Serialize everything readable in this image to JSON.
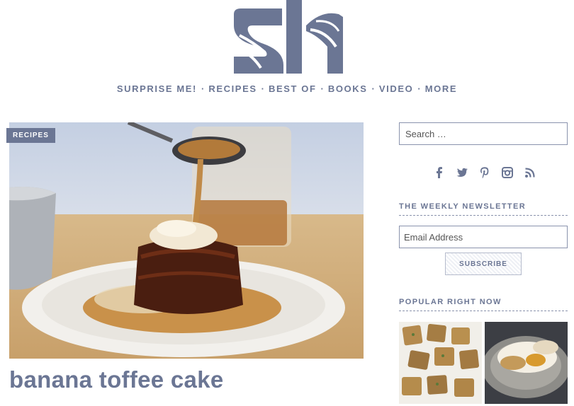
{
  "site": {
    "logo_text": "SK"
  },
  "nav": {
    "items": [
      "SURPRISE ME!",
      "RECIPES",
      "BEST OF",
      "BOOKS",
      "VIDEO",
      "MORE"
    ],
    "separator": "·"
  },
  "post": {
    "category": "RECIPES",
    "title": "banana toffee cake",
    "image_alt": "sticky toffee cake with caramel sauce"
  },
  "sidebar": {
    "search": {
      "placeholder": "Search …"
    },
    "social_icons": [
      "facebook-icon",
      "twitter-icon",
      "pinterest-icon",
      "instagram-icon",
      "rss-icon"
    ],
    "newsletter": {
      "heading": "THE WEEKLY NEWSLETTER",
      "email_placeholder": "Email Address",
      "button_label": "SUBSCRIBE"
    },
    "popular": {
      "heading": "POPULAR RIGHT NOW"
    }
  },
  "colors": {
    "accent": "#6b7694",
    "background": "#ffffff"
  }
}
